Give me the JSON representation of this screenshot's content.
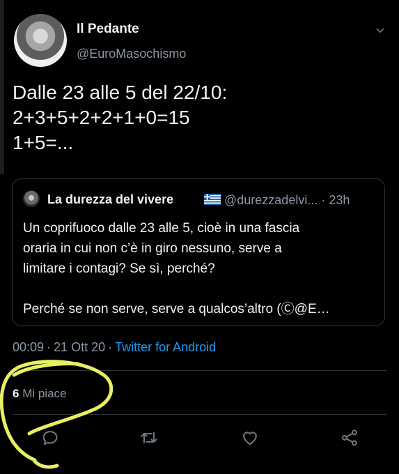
{
  "tweet": {
    "author_name": "Il Pedante",
    "author_handle": "@EuroMasochismo",
    "text_lines": [
      "Dalle 23 alle 5 del 22/10:",
      "2+3+5+2+2+1+0=15",
      "1+5=..."
    ],
    "time": "00:09",
    "date": "21 Ott 20",
    "client": "Twitter for Android",
    "likes_count": "6",
    "likes_label": "Mi piace"
  },
  "quoted": {
    "name": "La durezza del vivere",
    "handle": "@durezzadelvi...",
    "age": "23h",
    "text_lines": [
      "Un coprifuoco dalle 23 alle 5, cioè in una fascia",
      "oraria in cui non c’è in giro nessuno, serve a",
      "limitare i contagi? Se sì, perché?",
      "",
      "Perché se non serve, serve a qualcos’altro (Ⓒ@E…"
    ]
  },
  "icons": [
    "avatar-icon",
    "chevron-down-icon",
    "greece-flag-icon",
    "reply-icon",
    "retweet-icon",
    "like-icon",
    "share-icon"
  ],
  "colors": {
    "background": "#000000",
    "text": "#e7e9ea",
    "secondary": "#8b98a5",
    "link": "#1d9bf0",
    "border": "#2f3336",
    "highlight": "#e8ef63"
  }
}
